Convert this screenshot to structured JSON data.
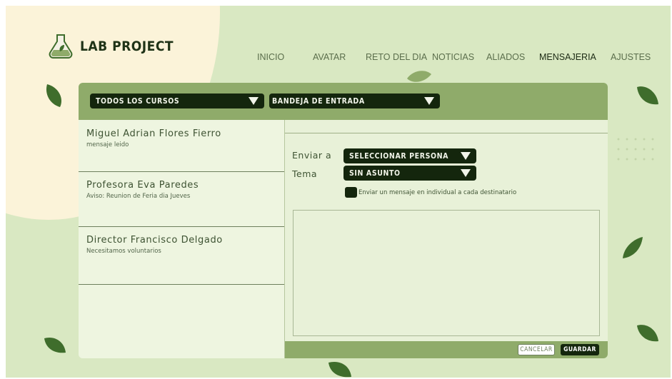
{
  "brand": {
    "title": "LAB PROJECT",
    "logo_icon": "flask-icon"
  },
  "nav": {
    "items": [
      {
        "label": "INICIO"
      },
      {
        "label": "AVATAR"
      },
      {
        "label": "RETO DEL DIA"
      },
      {
        "label": "NOTICIAS"
      },
      {
        "label": "ALIADOS"
      },
      {
        "label": "MENSAJERIA"
      },
      {
        "label": "AJUSTES"
      }
    ],
    "active": "MENSAJERIA"
  },
  "filters": {
    "courses_select": "TODOS LOS CURSOS",
    "folder_select": "BANDEJA DE ENTRADA"
  },
  "messages": [
    {
      "name": "Miguel Adrian Flores Fierro",
      "preview": "mensaje leido"
    },
    {
      "name": "Profesora Eva Paredes",
      "preview": "Aviso: Reunion de Feria dia Jueves"
    },
    {
      "name": "Director Francisco Delgado",
      "preview": "Necesitamos voluntarios"
    }
  ],
  "compose": {
    "to_label": "Enviar a",
    "to_value": "SELECCIONAR PERSONA",
    "subject_label": "Tema",
    "subject_value": "SIN ASUNTO",
    "individual_label": "Enviar un mensaje en individual a cada destinatario",
    "body": "",
    "cancel_label": "CANCELAR",
    "save_label": "GUARDAR"
  },
  "colors": {
    "background": "#d9e8c2",
    "accent_dark": "#14260d",
    "bar_green": "#8fab6a",
    "panel_light": "#eef5e0",
    "leaf_green": "#3f6d2c"
  }
}
